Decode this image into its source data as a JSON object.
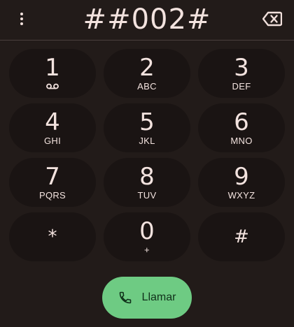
{
  "dialer": {
    "number": "##002#",
    "more_icon": "more-vert-icon",
    "backspace_icon": "backspace-icon"
  },
  "keypad": [
    {
      "digit": "1",
      "letters": "",
      "sub_icon": "voicemail-icon"
    },
    {
      "digit": "2",
      "letters": "ABC"
    },
    {
      "digit": "3",
      "letters": "DEF"
    },
    {
      "digit": "4",
      "letters": "GHI"
    },
    {
      "digit": "5",
      "letters": "JKL"
    },
    {
      "digit": "6",
      "letters": "MNO"
    },
    {
      "digit": "7",
      "letters": "PQRS"
    },
    {
      "digit": "8",
      "letters": "TUV"
    },
    {
      "digit": "9",
      "letters": "WXYZ"
    },
    {
      "digit": "*",
      "letters": ""
    },
    {
      "digit": "0",
      "letters": "+"
    },
    {
      "digit": "#",
      "letters": ""
    }
  ],
  "call": {
    "label": "Llamar",
    "icon": "phone-icon"
  },
  "colors": {
    "background": "#221b19",
    "key_background": "#1a1413",
    "call_button": "#6ecb83",
    "text": "#f3e3df"
  }
}
